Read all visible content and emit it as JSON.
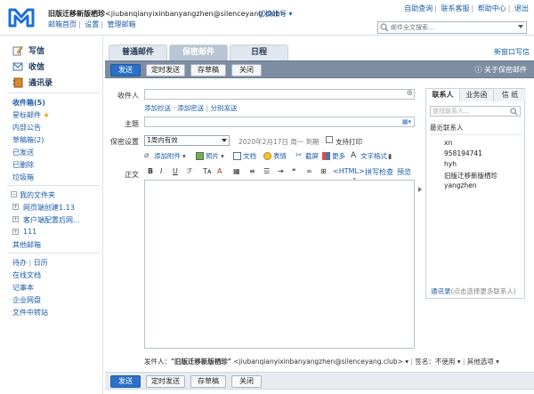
{
  "header": {
    "user_display": "旧版迁移新版栖珍",
    "user_email": "<jiubanqianyixinbanyangzhen@silenceyang.club>",
    "switch_account": "切换帐号",
    "top_links": [
      "邮箱首页",
      "设置",
      "管理邮箱"
    ],
    "right_links": [
      "自助查询",
      "联系客服",
      "帮助中心",
      "退出"
    ],
    "search_placeholder": "邮件全文搜索..."
  },
  "sidebar": {
    "main": [
      "写信",
      "收信",
      "通讯录"
    ],
    "folders": [
      {
        "label": "收件箱(5)",
        "bold": true
      },
      {
        "label": "星标邮件",
        "star": true
      },
      {
        "label": "内部公告"
      },
      {
        "label": "草稿箱(2)"
      },
      {
        "label": "已发送"
      },
      {
        "label": "已删除"
      },
      {
        "label": "垃圾箱"
      }
    ],
    "my_folders_title": "我的文件夹",
    "my_folders": [
      "网页端创建1.13",
      "客户端配置后网...",
      "111"
    ],
    "other_mailbox": "其他邮箱",
    "tools_row": [
      "待办",
      "日历"
    ],
    "tools": [
      "在线文档",
      "记事本",
      "企业网盘",
      "文件中转站"
    ]
  },
  "tabs": [
    "普通邮件",
    "保密邮件",
    "日程"
  ],
  "active_tab": 1,
  "new_window": "新窗口写信",
  "toolbar": {
    "send": "发送",
    "scheduled": "定时发送",
    "save_draft": "存草稿",
    "close": "关闭",
    "about_secure": "关于保密邮件"
  },
  "compose": {
    "to_label": "收件人",
    "cc_links": [
      "添加抄送",
      "添加密送",
      "分别发送"
    ],
    "subject_label": "主题",
    "secure_label": "保密设置",
    "expire_value": "1周内有效",
    "expire_text": "2020年2月17日 周一 到期",
    "print_label": "支持打印",
    "attach_items": [
      "添加附件",
      "照片",
      "文档",
      "表情",
      "截屏",
      "更多",
      "文字格式"
    ],
    "body_label": "正文",
    "editor_tools": [
      "B",
      "I",
      "U",
      "<HTML>",
      "拼写检查",
      "预览"
    ]
  },
  "contacts": {
    "tabs": [
      "联系人",
      "业务函",
      "信 纸"
    ],
    "search_placeholder": "查找联系人...",
    "recent_title": "最近联系人",
    "recent": [
      "xn",
      "958194741",
      "hyh",
      "旧版迁移新版栖珍",
      "yangzhen"
    ],
    "footer_link": "通讯录",
    "footer_hint": "(点击选择更多联系人)"
  },
  "sender_bar": {
    "label": "发件人：",
    "name": "\"旧版迁移新版栖珍\"",
    "email": "<jiubanqianyixinbanyangzhen@silenceyang.club>",
    "sign_label": "签名：",
    "sign_value": "不使用",
    "other_options": "其他选项"
  },
  "colors": {
    "primary": "#2c71c7",
    "link": "#1a5ca8",
    "toolbar_dark": "#7d8ea3"
  }
}
